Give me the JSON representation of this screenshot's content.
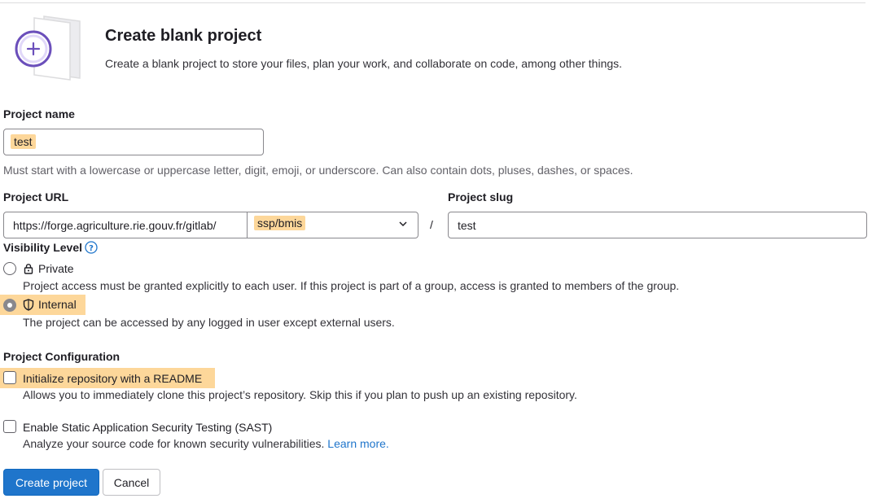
{
  "header": {
    "title": "Create blank project",
    "subtitle": "Create a blank project to store your files, plan your work, and collaborate on code, among other things."
  },
  "project_name": {
    "label": "Project name",
    "value": "test",
    "help": "Must start with a lowercase or uppercase letter, digit, emoji, or underscore. Can also contain dots, pluses, dashes, or spaces."
  },
  "project_url": {
    "label": "Project URL",
    "prefix": "https://forge.agriculture.rie.gouv.fr/gitlab/",
    "namespace": "ssp/bmis",
    "separator": "/"
  },
  "project_slug": {
    "label": "Project slug",
    "value": "test"
  },
  "visibility": {
    "label": "Visibility Level",
    "options": [
      {
        "label": "Private",
        "description": "Project access must be granted explicitly to each user. If this project is part of a group, access is granted to members of the group.",
        "selected": false,
        "icon": "lock-icon"
      },
      {
        "label": "Internal",
        "description": "The project can be accessed by any logged in user except external users.",
        "selected": true,
        "icon": "shield-icon"
      }
    ]
  },
  "configuration": {
    "label": "Project Configuration",
    "readme": {
      "label": "Initialize repository with a README",
      "description": "Allows you to immediately clone this project’s repository. Skip this if you plan to push up an existing repository.",
      "checked": false
    },
    "sast": {
      "label": "Enable Static Application Security Testing (SAST)",
      "description": "Analyze your source code for known security vulnerabilities.",
      "link": "Learn more.",
      "checked": false
    }
  },
  "actions": {
    "create": "Create project",
    "cancel": "Cancel"
  },
  "colors": {
    "primary": "#1f75cb",
    "highlight": "#fdd79a",
    "illustration_purple": "#6b4fbb"
  }
}
